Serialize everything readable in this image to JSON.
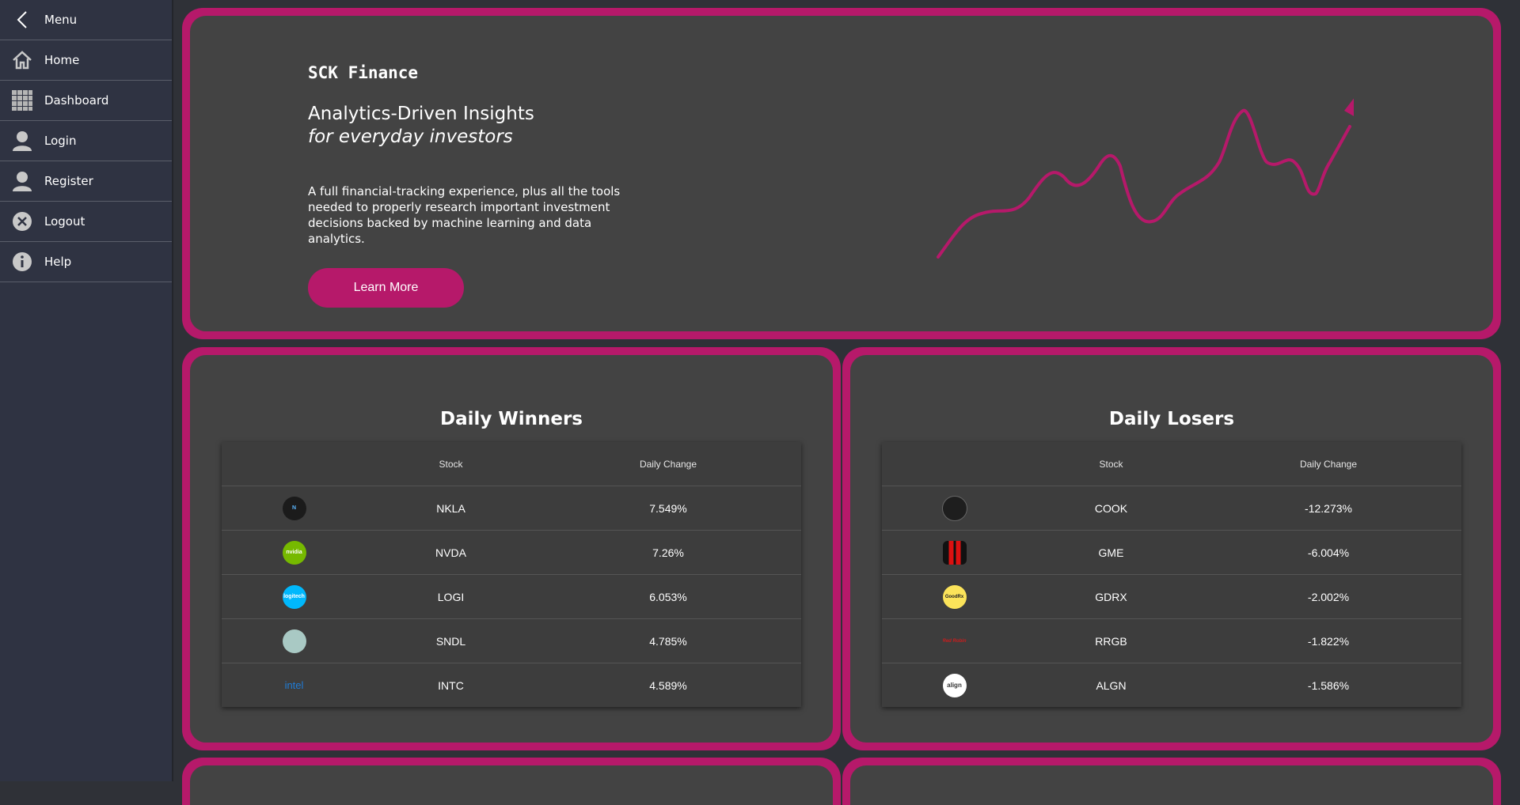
{
  "sidebar": {
    "menu_label": "Menu",
    "items": [
      {
        "label": "Home",
        "icon": "home-icon"
      },
      {
        "label": "Dashboard",
        "icon": "grid-icon"
      },
      {
        "label": "Login",
        "icon": "user-icon"
      },
      {
        "label": "Register",
        "icon": "user-icon"
      },
      {
        "label": "Logout",
        "icon": "close-circle-icon"
      },
      {
        "label": "Help",
        "icon": "info-icon"
      }
    ]
  },
  "hero": {
    "brand": "SCK Finance",
    "headline_line1": "Analytics-Driven Insights",
    "headline_line2": "for everyday investors",
    "description": "A full financial-tracking experience, plus all the tools needed to properly research important investment decisions backed by machine learning and data analytics.",
    "button_label": "Learn More",
    "art_icon": "trend-arrow-icon"
  },
  "colors": {
    "accent": "#b6196a",
    "panel": "#434343",
    "sidebar": "#2f3342"
  },
  "winners": {
    "title": "Daily Winners",
    "col_stock": "Stock",
    "col_change": "Daily Change",
    "rows": [
      {
        "ticker": "NKLA",
        "change": "7.549%",
        "logo_text": "N"
      },
      {
        "ticker": "NVDA",
        "change": "7.26%",
        "logo_text": "nvidia"
      },
      {
        "ticker": "LOGI",
        "change": "6.053%",
        "logo_text": "logitech"
      },
      {
        "ticker": "SNDL",
        "change": "4.785%",
        "logo_text": ""
      },
      {
        "ticker": "INTC",
        "change": "4.589%",
        "logo_text": "intel"
      }
    ]
  },
  "losers": {
    "title": "Daily Losers",
    "col_stock": "Stock",
    "col_change": "Daily Change",
    "rows": [
      {
        "ticker": "COOK",
        "change": "-12.273%",
        "logo_text": ""
      },
      {
        "ticker": "GME",
        "change": "-6.004%",
        "logo_text": ""
      },
      {
        "ticker": "GDRX",
        "change": "-2.002%",
        "logo_text": "GoodRx"
      },
      {
        "ticker": "RRGB",
        "change": "-1.822%",
        "logo_text": "Red Robin"
      },
      {
        "ticker": "ALGN",
        "change": "-1.586%",
        "logo_text": "align"
      }
    ]
  }
}
